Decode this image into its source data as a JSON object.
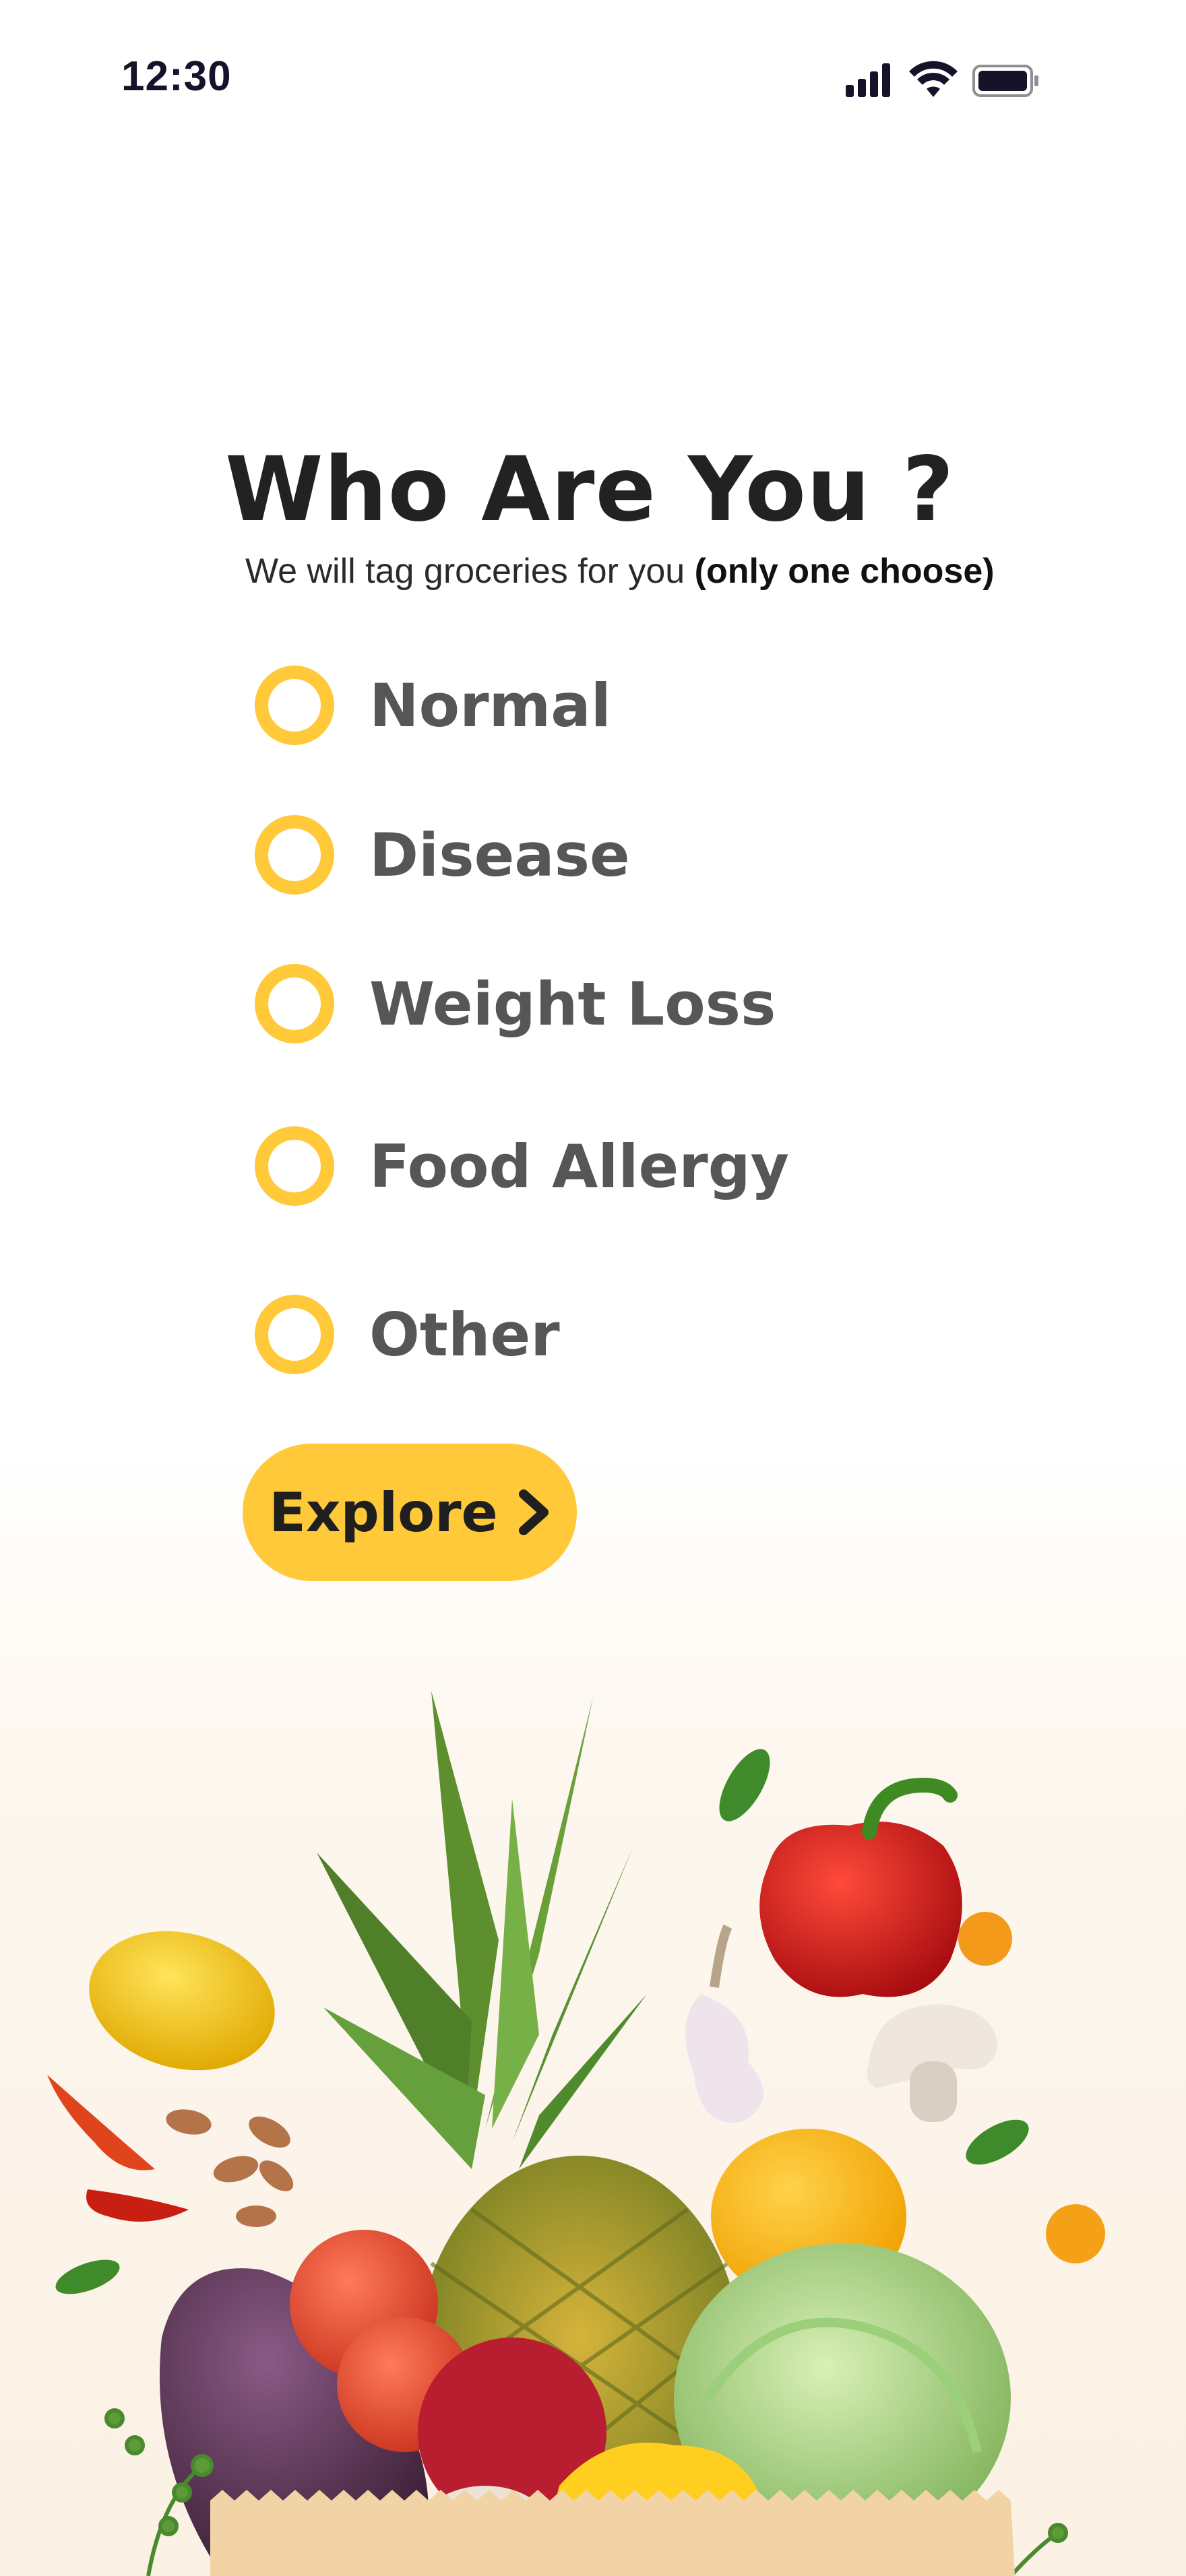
{
  "status_bar": {
    "time": "12:30",
    "icons": [
      "cellular-signal-icon",
      "wifi-icon",
      "battery-icon"
    ]
  },
  "header": {
    "title": "Who Are You ?",
    "subtitle": "We will tag groceries for you ",
    "subtitle_emphasis": "(only one choose)"
  },
  "options": [
    {
      "label": "Normal",
      "selected": false
    },
    {
      "label": "Disease",
      "selected": false
    },
    {
      "label": "Weight Loss",
      "selected": false
    },
    {
      "label": "Food Allergy",
      "selected": false
    },
    {
      "label": "Other",
      "selected": false
    }
  ],
  "explore_button": {
    "label": "Explore",
    "icon": "chevron-right-icon"
  },
  "illustration": {
    "items": [
      "pineapple",
      "bell-pepper",
      "lemon",
      "chili",
      "almonds",
      "garlic",
      "mushroom",
      "cherry-tomato",
      "orange",
      "eggplant",
      "tomato",
      "pomegranate",
      "cabbage",
      "yellow-pepper",
      "paper-bag"
    ]
  },
  "colors": {
    "accent": "#ffc93a",
    "title": "#222222",
    "option_text": "#565656",
    "background": "#ffffff"
  }
}
